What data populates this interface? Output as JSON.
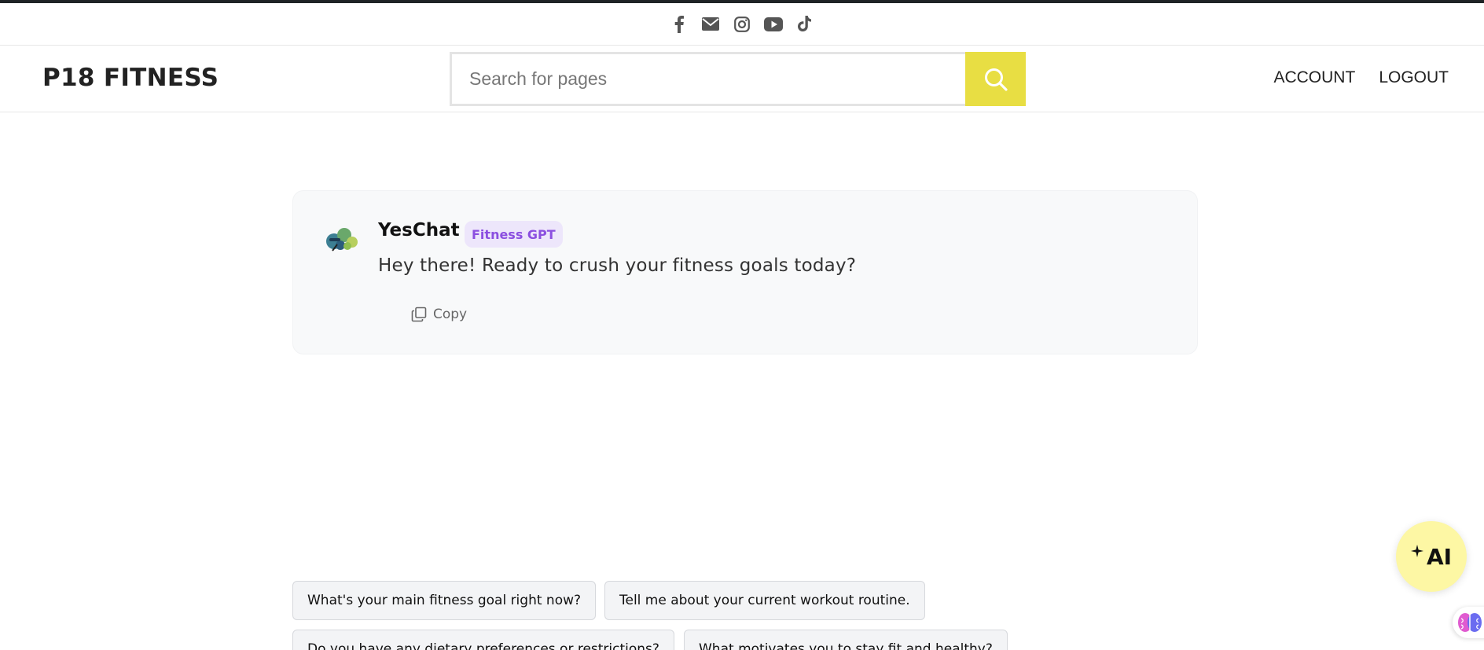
{
  "social": {
    "icons": [
      "facebook-icon",
      "email-icon",
      "instagram-icon",
      "youtube-icon",
      "tiktok-icon"
    ]
  },
  "header": {
    "logo": "P18 FITNESS",
    "search": {
      "placeholder": "Search for pages",
      "value": ""
    },
    "nav": {
      "account": "ACCOUNT",
      "logout": "LOGOUT"
    }
  },
  "chat": {
    "bot_name": "YesChat",
    "bot_tag": "Fitness GPT",
    "message": "Hey there! Ready to crush your fitness goals today?",
    "copy_label": "Copy"
  },
  "suggestions": [
    "What's your main fitness goal right now?",
    "Tell me about your current workout routine.",
    "Do you have any dietary preferences or restrictions?",
    "What motivates you to stay fit and healthy?"
  ],
  "fab": {
    "ai_label": "AI"
  },
  "colors": {
    "accent_yellow": "#e8de43",
    "tag_purple": "#8b4fe0",
    "tag_bg": "#ede6fb",
    "fab_bg": "#fdf7a4"
  }
}
